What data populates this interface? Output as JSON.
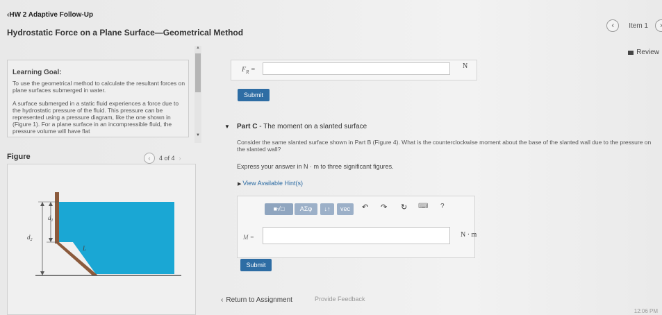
{
  "header": {
    "back_link": "HW 2 Adaptive Follow-Up",
    "title": "Hydrostatic Force on a Plane Surface—Geometrical Method",
    "item_label": "Item 1",
    "review_label": "Review"
  },
  "learning_goal": {
    "heading": "Learning Goal:",
    "text1": "To use the geometrical method to calculate the resultant forces on plane surfaces submerged in water.",
    "text2": "A surface submerged in a static fluid experiences a force due to the hydrostatic pressure of the fluid. This pressure can be represented using a pressure diagram, like the one shown in (Figure 1). For a plane surface in an incompressible fluid, the pressure volume will have flat"
  },
  "figure": {
    "label": "Figure",
    "pager": "4 of 4",
    "labels": {
      "d1": "d",
      "d1_sub": "1",
      "d2": "d",
      "d2_sub": "2",
      "L": "L"
    },
    "colors": {
      "water": "#1aa7d4",
      "wall": "#8b5a3c"
    }
  },
  "part_b": {
    "answer_label": "F",
    "answer_sub": "R",
    "answer_eq": " =",
    "answer_value": "",
    "unit": "N",
    "submit_label": "Submit"
  },
  "part_c": {
    "title_bold": "Part C",
    "title_rest": " - The moment on a slanted surface",
    "question": "Consider the same slanted surface shown in Part B (Figure 4). What is the counterclockwise moment about the base of the slanted wall due to the pressure on the slanted wall?",
    "express": "Express your answer in N · m to three significant figures.",
    "hints_label": "View Available Hint(s)",
    "toolbar": {
      "templates": "■√□",
      "greek": "ΑΣφ",
      "arrows": "↓↑",
      "vec": "vec",
      "undo": "↶",
      "redo": "↷",
      "reset": "↻",
      "keyboard": "⌨",
      "help": "?"
    },
    "answer_label": "M",
    "answer_eq": " =",
    "answer_value": "",
    "unit": "N · m",
    "submit_label": "Submit"
  },
  "footer": {
    "return_label": "Return to Assignment",
    "feedback_label": "Provide Feedback",
    "clock": "12:06 PM"
  },
  "colors": {
    "accent": "#2e6da4"
  }
}
